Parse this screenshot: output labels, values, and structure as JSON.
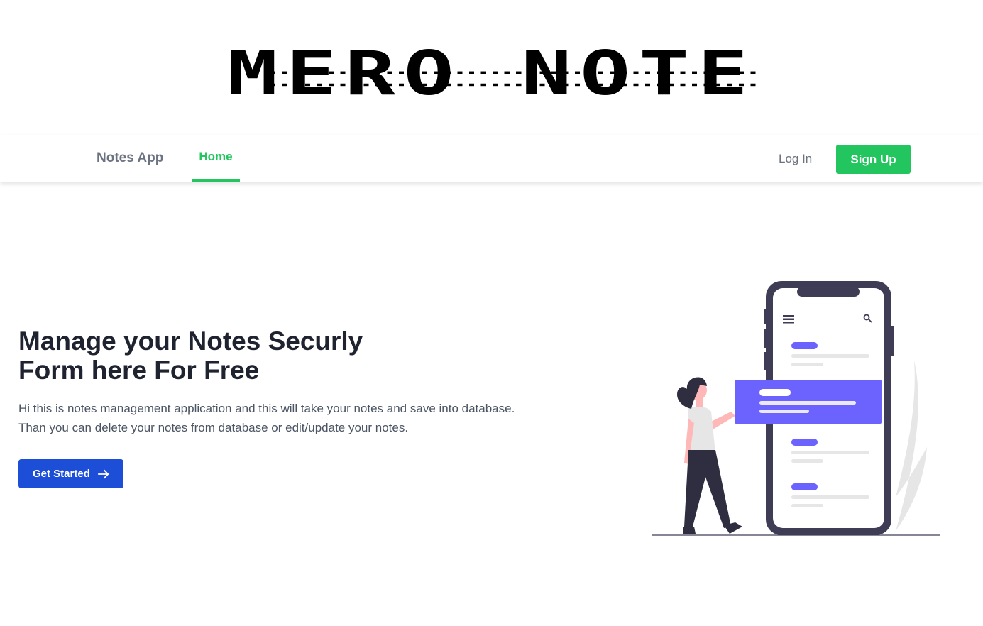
{
  "logo": {
    "text": "MERO NOTE"
  },
  "navbar": {
    "brand": "Notes App",
    "links": [
      {
        "label": "Home",
        "active": true
      }
    ],
    "login_label": "Log In",
    "signup_label": "Sign Up"
  },
  "hero": {
    "title_line1": "Manage your Notes Securly",
    "title_line2": "Form here For Free",
    "description": "Hi this is notes management application and this will take your notes and save into database. Than you can delete your notes from database or edit/update your notes.",
    "cta_label": "Get Started",
    "cta_icon": "arrow-right-icon"
  },
  "illustration": {
    "icons": [
      "menu-icon",
      "search-icon"
    ]
  },
  "colors": {
    "accent_green": "#22c55e",
    "primary_blue": "#1d4ed8",
    "illustration_purple": "#6c63ff",
    "phone_frame": "#3f3d56",
    "skin": "#ffb8b8"
  }
}
